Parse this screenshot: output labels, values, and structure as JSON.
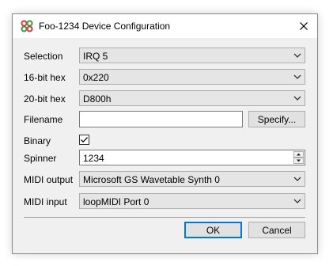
{
  "window": {
    "title": "Foo-1234 Device Configuration",
    "close_glyph": "✕"
  },
  "fields": {
    "selection": {
      "label": "Selection",
      "value": "IRQ 5"
    },
    "hex16": {
      "label": "16-bit hex",
      "value": "0x220"
    },
    "hex20": {
      "label": "20-bit hex",
      "value": "D800h"
    },
    "filename": {
      "label": "Filename",
      "value": "",
      "button": "Specify..."
    },
    "binary": {
      "label": "Binary",
      "checked": true
    },
    "spinner": {
      "label": "Spinner",
      "value": "1234"
    },
    "midi_output": {
      "label": "MIDI output",
      "value": "Microsoft GS Wavetable Synth 0"
    },
    "midi_input": {
      "label": "MIDI input",
      "value": "loopMIDI Port 0"
    }
  },
  "buttons": {
    "ok": "OK",
    "cancel": "Cancel"
  },
  "icons": {
    "app": "device-config-icon",
    "close": "close-icon",
    "dropdown": "chevron-down-icon",
    "check": "check-icon"
  },
  "colors": {
    "accent": "#0078d7",
    "face": "#f0f0f0",
    "icon_red": "#d83b3b",
    "icon_green": "#3a9a3a"
  }
}
